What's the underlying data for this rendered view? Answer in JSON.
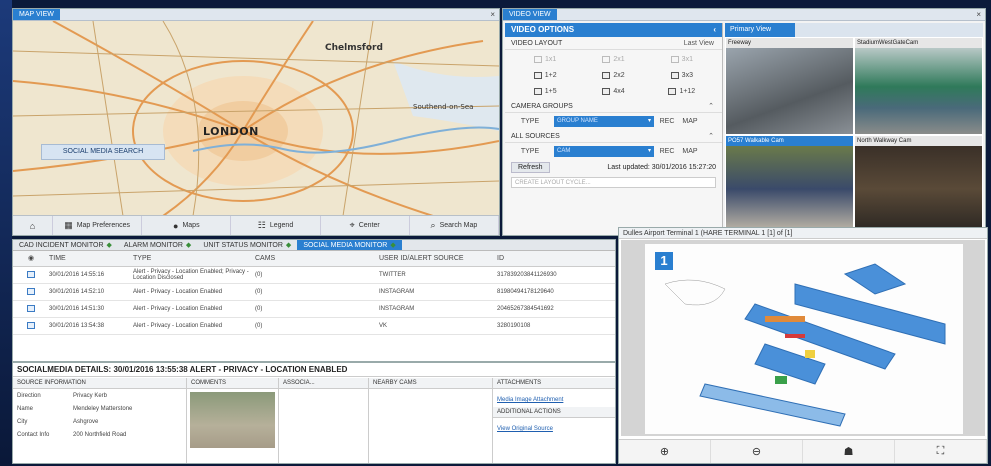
{
  "map": {
    "tab": "MAP VIEW",
    "labels": {
      "london": "LONDON",
      "chelmsford": "Chelmsford",
      "southend": "Southend-on-Sea"
    },
    "social_button": "SOCIAL MEDIA SEARCH",
    "toolbar": {
      "preferences": "Map Preferences",
      "maps": "Maps",
      "legend": "Legend",
      "center": "Center",
      "search": "Search Map"
    }
  },
  "video": {
    "tab": "VIDEO VIEW",
    "options_title": "VIDEO OPTIONS",
    "layout_label": "VIDEO LAYOUT",
    "layout_value": "Last View",
    "layouts": [
      {
        "label": "1x1",
        "dim": true
      },
      {
        "label": "2x1",
        "dim": true
      },
      {
        "label": "3x1",
        "dim": true
      },
      {
        "label": "1+2",
        "dim": false
      },
      {
        "label": "2x2",
        "dim": false
      },
      {
        "label": "3x3",
        "dim": false
      },
      {
        "label": "1+5",
        "dim": false
      },
      {
        "label": "4x4",
        "dim": false
      },
      {
        "label": "1+12",
        "dim": false
      }
    ],
    "camera_groups_label": "CAMERA GROUPS",
    "groups_type_label": "TYPE",
    "groups_type_value": "GROUP NAME",
    "groups_rec": "REC",
    "groups_map": "MAP",
    "all_sources_label": "ALL SOURCES",
    "sources_type_label": "TYPE",
    "sources_type_value": "CAM",
    "sources_rec": "REC",
    "sources_map": "MAP",
    "refresh_label": "Refresh",
    "last_updated": "Last updated: 30/01/2016 15:27:20",
    "layout_placeholder": "CREATE LAYOUT CYCLE..."
  },
  "primary_view": {
    "tab": "Primary View",
    "cameras": [
      {
        "title": "Freeway",
        "selected": false
      },
      {
        "title": "StadiumWestGateCam",
        "selected": false
      },
      {
        "title": "PO57 Walkable Cam",
        "selected": true
      },
      {
        "title": "North Walkway Cam",
        "selected": false
      }
    ]
  },
  "monitor": {
    "tabs": [
      {
        "label": "CAD INCIDENT MONITOR",
        "active": false
      },
      {
        "label": "ALARM MONITOR",
        "active": false
      },
      {
        "label": "UNIT STATUS MONITOR",
        "active": false
      },
      {
        "label": "SOCIAL MEDIA MONITOR",
        "active": true
      }
    ],
    "columns": {
      "time": "TIME",
      "type": "TYPE",
      "cams": "CAMS",
      "user": "USER ID/ALERT SOURCE",
      "id": "ID"
    },
    "rows": [
      {
        "time": "30/01/2016 14:55:16",
        "type": "Alert - Privacy - Location Enabled; Privacy - Location Disclosed",
        "cams": "(0)",
        "user": "TWITTER",
        "id": "317839203841126930"
      },
      {
        "time": "30/01/2016 14:52:10",
        "type": "Alert - Privacy - Location Enabled",
        "cams": "(0)",
        "user": "INSTAGRAM",
        "id": "81980494178129640"
      },
      {
        "time": "30/01/2016 14:51:30",
        "type": "Alert - Privacy - Location Enabled",
        "cams": "(0)",
        "user": "INSTAGRAM",
        "id": "20465267384541692"
      },
      {
        "time": "30/01/2016 13:54:38",
        "type": "Alert - Privacy - Location Enabled",
        "cams": "(0)",
        "user": "VK",
        "id": "3280190108"
      }
    ]
  },
  "details": {
    "title": "SOCIALMEDIA DETAILS: 30/01/2016 13:55:38 ALERT - PRIVACY - LOCATION ENABLED",
    "source_header": "SOURCE INFORMATION",
    "source_fields": [
      {
        "k": "Direction",
        "v": "Privacy Kerb"
      },
      {
        "k": "Name",
        "v": "Mendeley Matterstone"
      },
      {
        "k": "City",
        "v": "Ashgrove"
      },
      {
        "k": "Contact Info",
        "v": "200 Northfield Road"
      }
    ],
    "comments_header": "COMMENTS",
    "associated_header": "ASSOCIA...",
    "nearby_header": "NEARBY CAMS",
    "attachments_header": "ATTACHMENTS",
    "attachment_link": "Media Image Attachment",
    "additional_header": "ADDITIONAL ACTIONS",
    "additional_link": "View Original Source"
  },
  "plan": {
    "title": "Dulles Airport Terminal 1 (HARE TERMINAL 1 [1] of [1]",
    "badge": "1"
  }
}
